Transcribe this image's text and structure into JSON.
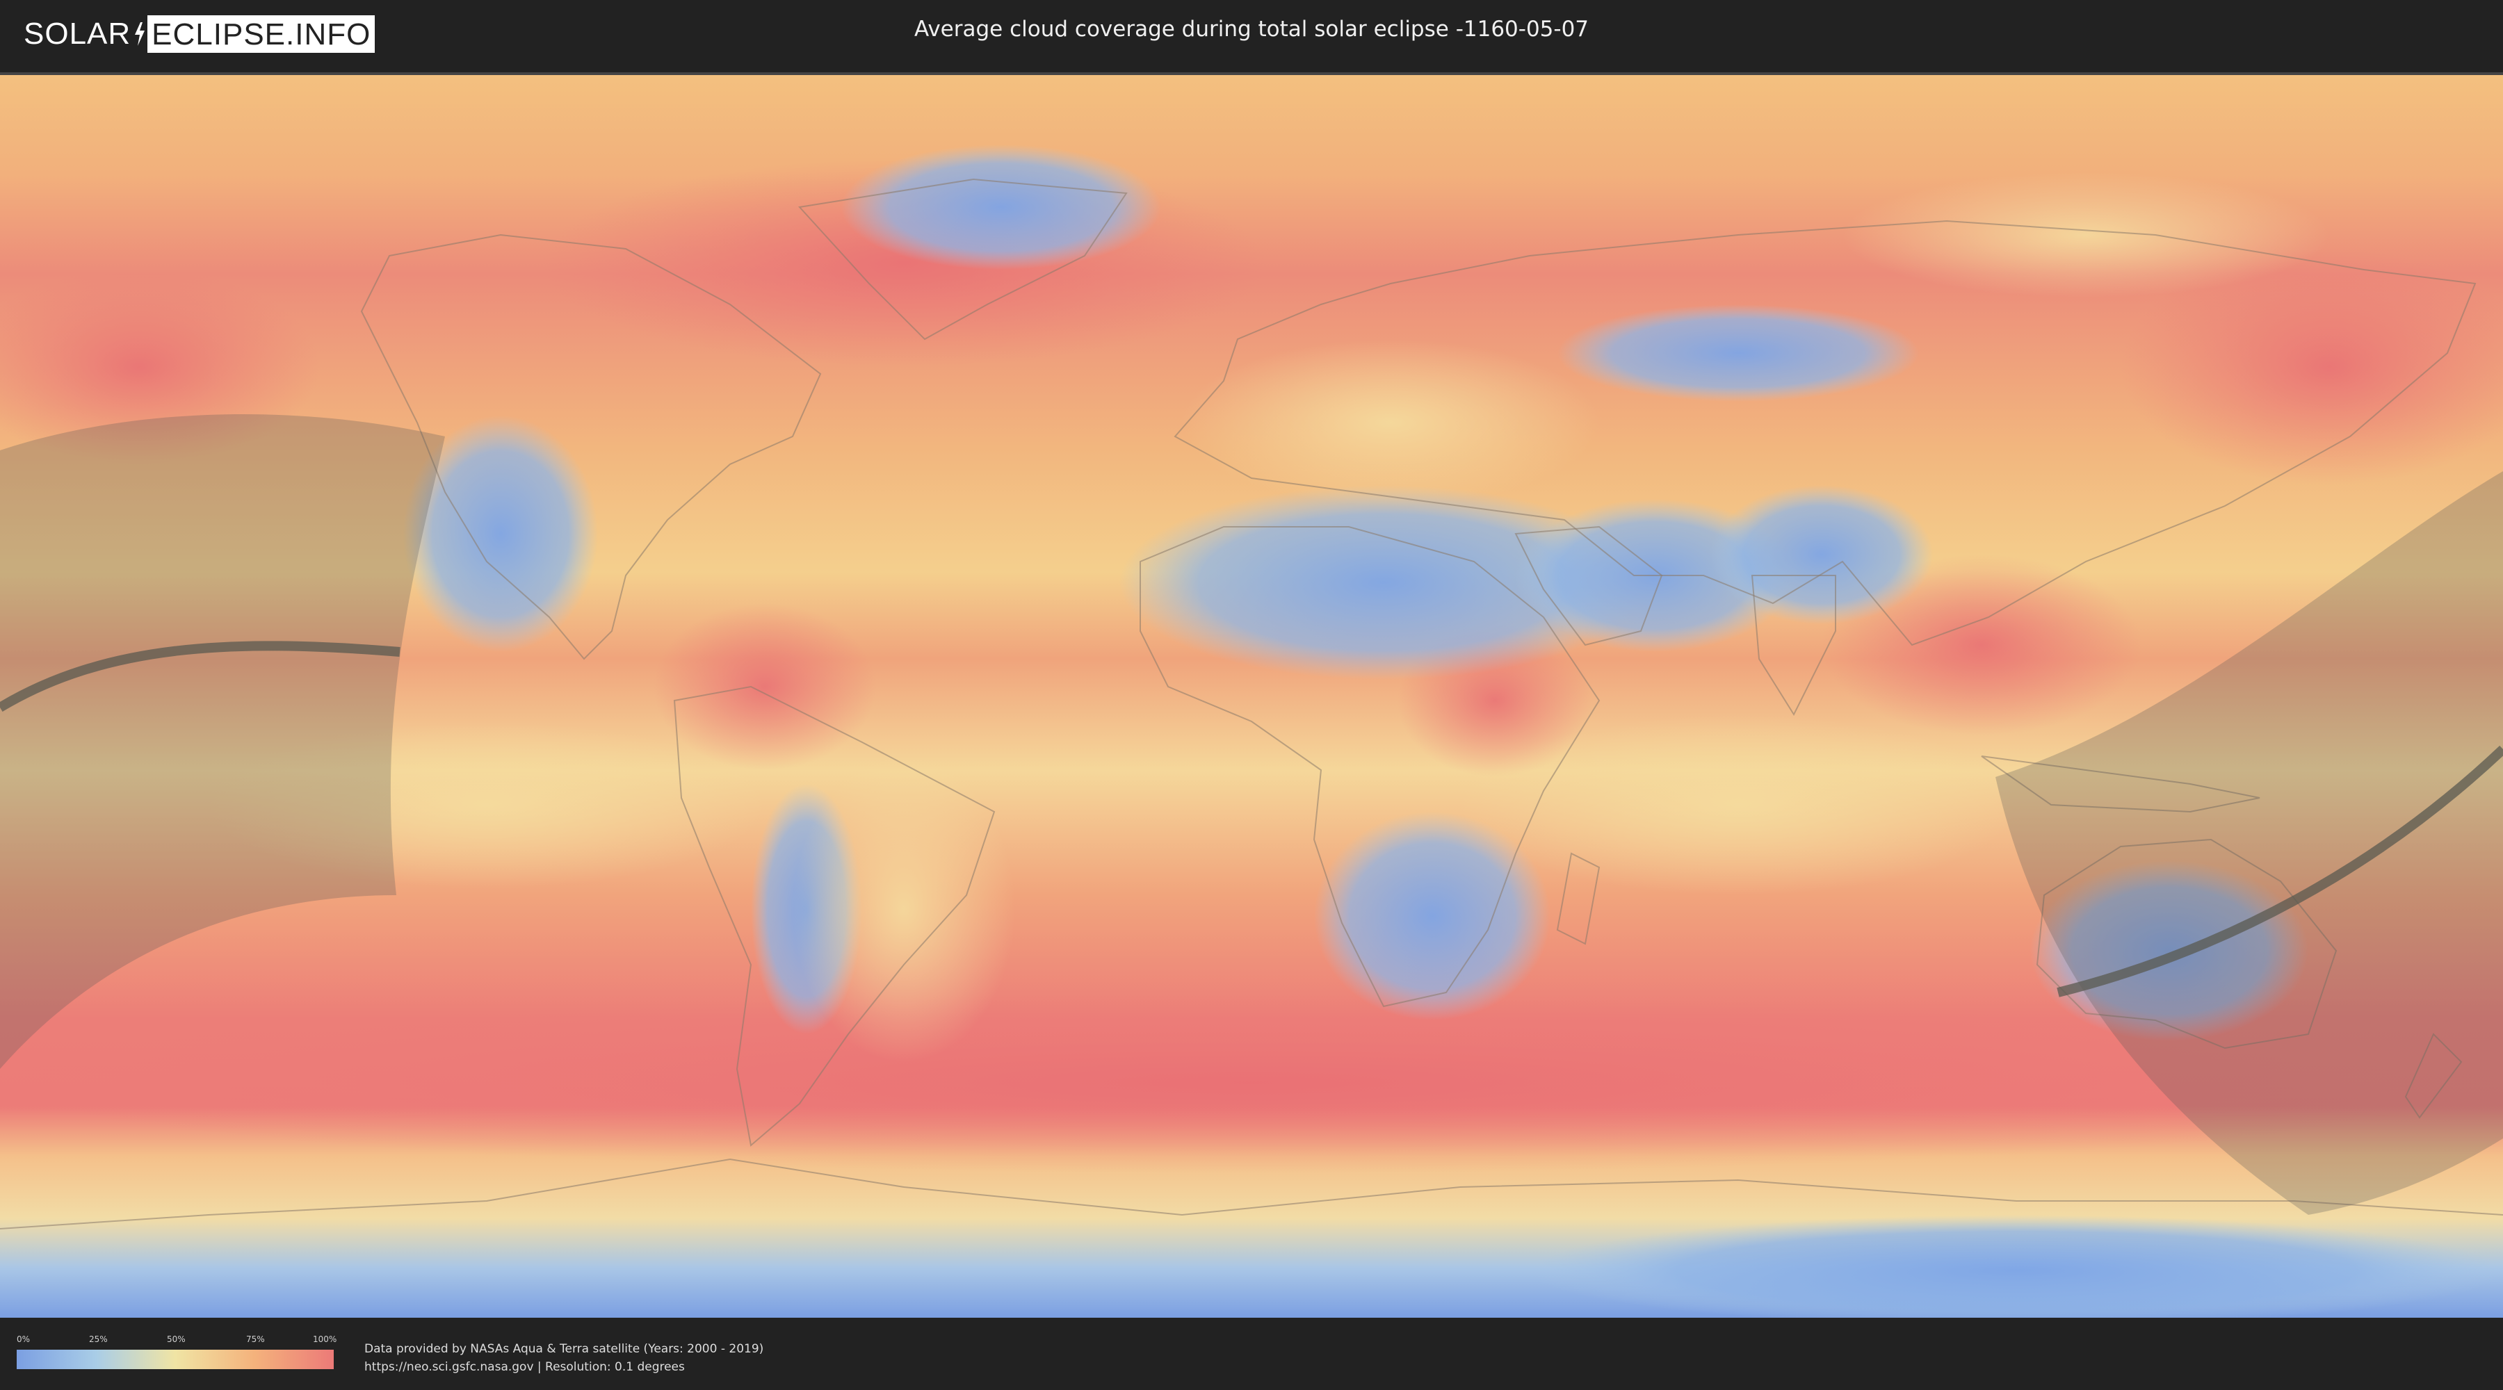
{
  "header": {
    "logo_left": "SOLAR",
    "logo_right": "ECLIPSE.INFO",
    "title": "Average cloud coverage during total solar eclipse -1160-05-07"
  },
  "legend": {
    "ticks": [
      "0%",
      "25%",
      "50%",
      "75%",
      "100%"
    ],
    "colors": [
      "#7b9fe2",
      "#a9cde7",
      "#f0e4a4",
      "#f4b27c",
      "#ec7a78"
    ]
  },
  "footer": {
    "credit_line_1": "Data provided by NASAs Aqua & Terra satellite (Years: 2000 - 2019)",
    "credit_line_2": "https://neo.sci.gsfc.nasa.gov | Resolution: 0.1 degrees"
  },
  "colors": {
    "background": "#222222",
    "clear": "#7b9fe2",
    "partly": "#f0e4a4",
    "cloudy": "#ec7a78",
    "eclipse_shadow": "#555555",
    "path_line": "#555555"
  },
  "icons": {
    "logo_mark": "lightning-bolt-icon"
  }
}
